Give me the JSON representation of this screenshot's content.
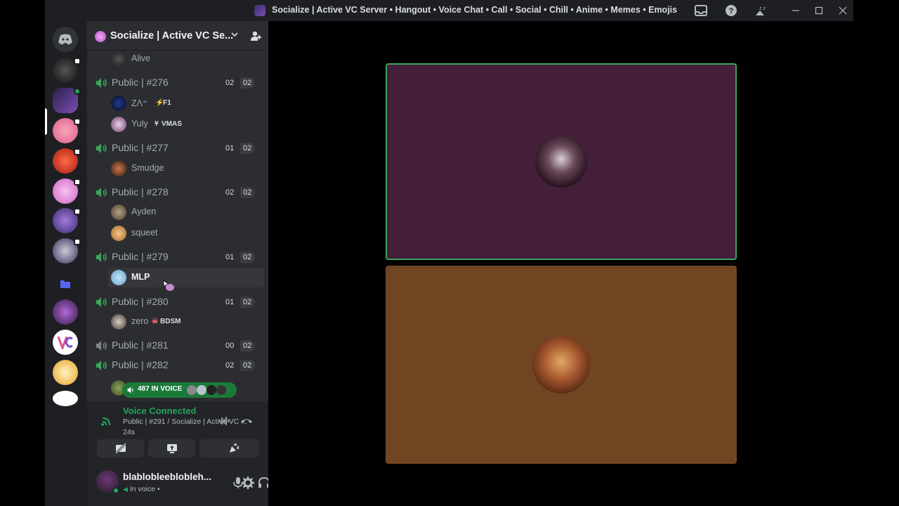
{
  "window": {
    "title": "Socialize | Active VC Server • Hangout • Voice Chat • Call • Social • Chill • Anime • Memes • Emojis"
  },
  "guild": {
    "name": "Socialize | Active VC Se...",
    "invite_icon": "add-member-icon"
  },
  "channels": {
    "top_member": "Alive",
    "voice": [
      {
        "name": "Public | #276",
        "count": "02",
        "limit": "02",
        "members": [
          {
            "name": "ZΛ⁼",
            "tag": "F1"
          },
          {
            "name": "Yuly",
            "tag": "VMAS"
          }
        ]
      },
      {
        "name": "Public | #277",
        "count": "01",
        "limit": "02",
        "members": [
          {
            "name": "Smudge",
            "tag": ""
          }
        ]
      },
      {
        "name": "Public | #278",
        "count": "02",
        "limit": "02",
        "members": [
          {
            "name": "Ayden",
            "tag": ""
          },
          {
            "name": "squeet",
            "tag": ""
          }
        ]
      },
      {
        "name": "Public | #279",
        "count": "01",
        "limit": "02",
        "members": [
          {
            "name": "MLP",
            "tag": ""
          }
        ]
      },
      {
        "name": "Public | #280",
        "count": "01",
        "limit": "02",
        "members": [
          {
            "name": "zero",
            "tag": "BDSM"
          }
        ]
      },
      {
        "name": "Public | #281",
        "count": "00",
        "limit": "02",
        "members": []
      },
      {
        "name": "Public | #282",
        "count": "02",
        "limit": "02",
        "members": []
      }
    ],
    "in_voice_pill": "487 IN VOICE"
  },
  "voice_panel": {
    "status": "Voice Connected",
    "channel": "Public | #291 / Socialize | Active VC ...",
    "elapsed": "24s"
  },
  "user": {
    "name": "blablobleeblobleh...",
    "sub": "In voice •"
  },
  "colors": {
    "accent_green": "#23a55a",
    "tile1_bg": "#431f3a",
    "tile2_bg": "#704622"
  }
}
